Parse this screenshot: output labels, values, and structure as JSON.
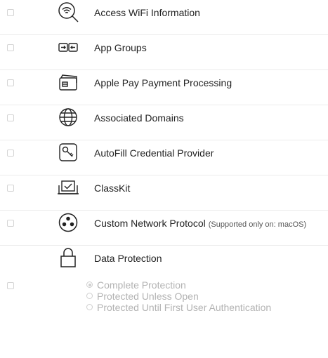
{
  "capabilities": [
    {
      "label": "Access WiFi Information",
      "note": "",
      "icon": "wifi-search-icon"
    },
    {
      "label": "App Groups",
      "note": "",
      "icon": "app-groups-icon"
    },
    {
      "label": "Apple Pay Payment Processing",
      "note": "",
      "icon": "apple-pay-card-icon"
    },
    {
      "label": "Associated Domains",
      "note": "",
      "icon": "globe-icon"
    },
    {
      "label": "AutoFill Credential Provider",
      "note": "",
      "icon": "key-icon"
    },
    {
      "label": "ClassKit",
      "note": "",
      "icon": "classkit-icon"
    },
    {
      "label": "Custom Network Protocol",
      "note": "(Supported only on: macOS)",
      "icon": "network-protocol-icon"
    },
    {
      "label": "Data Protection",
      "note": "",
      "icon": "lock-icon"
    }
  ],
  "data_protection_options": [
    {
      "label": "Complete Protection",
      "selected": true
    },
    {
      "label": "Protected Unless Open",
      "selected": false
    },
    {
      "label": "Protected Until First User Authentication",
      "selected": false
    }
  ],
  "colors": {
    "text": "#222222",
    "disabled_text": "#b3b3b3",
    "divider": "#ececec"
  }
}
